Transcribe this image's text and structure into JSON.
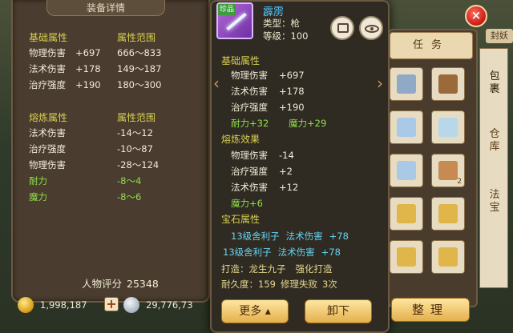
{
  "left_panel": {
    "title": "装备详情",
    "basic_header": "基础属性",
    "range_header": "属性范围",
    "basic_rows": [
      {
        "name": "物理伤害",
        "value": "+697",
        "range": "666～833"
      },
      {
        "name": "法术伤害",
        "value": "+178",
        "range": "149～187"
      },
      {
        "name": "治疗强度",
        "value": "+190",
        "range": "180～300"
      }
    ],
    "refine_header": "熔炼属性",
    "refine_range_header": "属性范围",
    "refine_rows": [
      {
        "name": "法术伤害",
        "range": "-14～12",
        "green": false
      },
      {
        "name": "治疗强度",
        "range": "-10～87",
        "green": false
      },
      {
        "name": "物理伤害",
        "range": "-28～124",
        "green": false
      },
      {
        "name": "耐力",
        "range": "-8～4",
        "green": true
      },
      {
        "name": "魔力",
        "range": "-8～6",
        "green": true
      }
    ],
    "score_label": "人物评分",
    "score_value": "25348"
  },
  "currency": {
    "gold": "1,998,187",
    "plus": "+",
    "silver": "29,776,73"
  },
  "item": {
    "badge": "珍品",
    "name": "霹雳",
    "type": "类型：枪",
    "level": "等级：100",
    "basic_header": "基础属性",
    "basic_rows": [
      {
        "name": "物理伤害",
        "value": "+697"
      },
      {
        "name": "法术伤害",
        "value": "+178"
      },
      {
        "name": "治疗强度",
        "value": "+190"
      }
    ],
    "bonus": {
      "stamina": "耐力+32",
      "mana": "魔力+29"
    },
    "refine_header": "熔炼效果",
    "refine_rows": [
      {
        "name": "物理伤害",
        "value": "-14"
      },
      {
        "name": "治疗强度",
        "value": "+2"
      },
      {
        "name": "法术伤害",
        "value": "+12"
      }
    ],
    "refine_mana": "魔力+6",
    "gem_header": "宝石属性",
    "gem_rows": [
      {
        "gem": "13级舍利子",
        "stat": "法术伤害",
        "value": "+78"
      },
      {
        "gem": "13级舍利子",
        "stat": "法术伤害",
        "value": "+78"
      }
    ],
    "forge_label": "打造：",
    "forge_by": "龙生九子",
    "forge_type": "强化打造",
    "durability": "耐久度：159",
    "repair_fail": "修理失败",
    "repair_count": "3次",
    "more_button": "更多",
    "unequip_button": "卸下"
  },
  "bag": {
    "tab_label": "任务",
    "side_tabs": [
      "包裹",
      "仓库",
      "法宝"
    ],
    "sort_button": "整理",
    "corner_tag": "封妖",
    "slot_counts": [
      "",
      "",
      "",
      "",
      "",
      "",
      "",
      "",
      "2",
      "",
      "",
      "",
      "",
      ""
    ],
    "close_icon": "×"
  }
}
